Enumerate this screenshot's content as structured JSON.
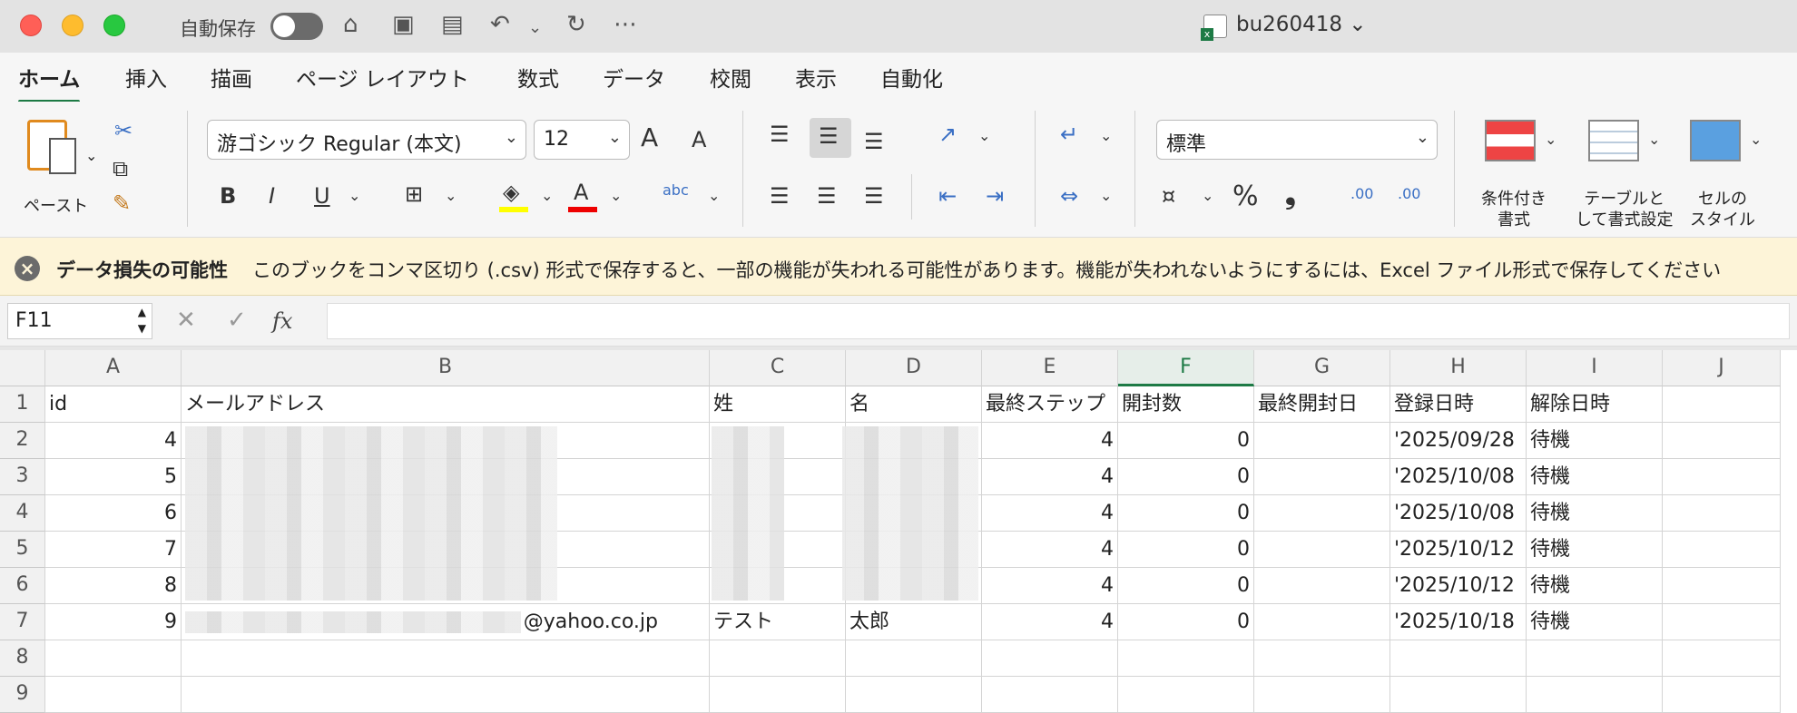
{
  "titlebar": {
    "autosave_label": "自動保存",
    "doc_title": "bu260418 ⌄"
  },
  "tabs": [
    {
      "label": "ホーム"
    },
    {
      "label": "挿入"
    },
    {
      "label": "描画"
    },
    {
      "label": "ページ レイアウト"
    },
    {
      "label": "数式"
    },
    {
      "label": "データ"
    },
    {
      "label": "校閲"
    },
    {
      "label": "表示"
    },
    {
      "label": "自動化"
    }
  ],
  "ribbon": {
    "paste_label": "ペースト",
    "font_name": "游ゴシック Regular (本文)",
    "font_size": "12",
    "number_format": "標準",
    "cond_format": "条件付き\n書式",
    "table_format": "テーブルと\nして書式設定",
    "cell_style": "セルの\nスタイル",
    "bold": "B",
    "italic": "I",
    "underline": "U",
    "percent": "%",
    "comma": "❟",
    "grow": "A",
    "shrink": "A",
    "font_color_letter": "A",
    "abc": "abc",
    "dec_inc": ".00",
    "dec_dec": ".00"
  },
  "warning": {
    "title": "データ損失の可能性",
    "message": "このブックをコンマ区切り (.csv) 形式で保存すると、一部の機能が失われる可能性があります。機能が失われないようにするには、Excel ファイル形式で保存してください"
  },
  "formula_bar": {
    "name_box": "F11",
    "fx": "fx",
    "formula": ""
  },
  "sheet": {
    "columns": [
      "A",
      "B",
      "C",
      "D",
      "E",
      "F",
      "G",
      "H",
      "I",
      "J"
    ],
    "selected_column": "F",
    "row_numbers": [
      "1",
      "2",
      "3",
      "4",
      "5",
      "6",
      "7",
      "8",
      "9"
    ],
    "header_row": [
      "id",
      "メールアドレス",
      "姓",
      "名",
      "最終ステップ",
      "開封数",
      "最終開封日",
      "登録日時",
      "解除日時"
    ],
    "rows": [
      {
        "id": "4",
        "email": "",
        "sei": "",
        "mei": "",
        "step": "4",
        "opens": "0",
        "last_open": "",
        "registered": "'2025/09/28",
        "unsub": "待機"
      },
      {
        "id": "5",
        "email": "",
        "sei": "",
        "mei": "",
        "step": "4",
        "opens": "0",
        "last_open": "",
        "registered": "'2025/10/08",
        "unsub": "待機"
      },
      {
        "id": "6",
        "email": "",
        "sei": "",
        "mei": "",
        "step": "4",
        "opens": "0",
        "last_open": "",
        "registered": "'2025/10/08",
        "unsub": "待機"
      },
      {
        "id": "7",
        "email": "",
        "sei": "",
        "mei": "",
        "step": "4",
        "opens": "0",
        "last_open": "",
        "registered": "'2025/10/12",
        "unsub": "待機"
      },
      {
        "id": "8",
        "email": "",
        "sei": "",
        "mei": "",
        "step": "4",
        "opens": "0",
        "last_open": "",
        "registered": "'2025/10/12",
        "unsub": "待機"
      },
      {
        "id": "9",
        "email": "@yahoo.co.jp",
        "sei": "テスト",
        "mei": "太郎",
        "step": "4",
        "opens": "0",
        "last_open": "",
        "registered": "'2025/10/18",
        "unsub": "待機"
      }
    ]
  },
  "colors": {
    "accent": "#1d7a45",
    "warning_bg": "#fdf4d8"
  }
}
